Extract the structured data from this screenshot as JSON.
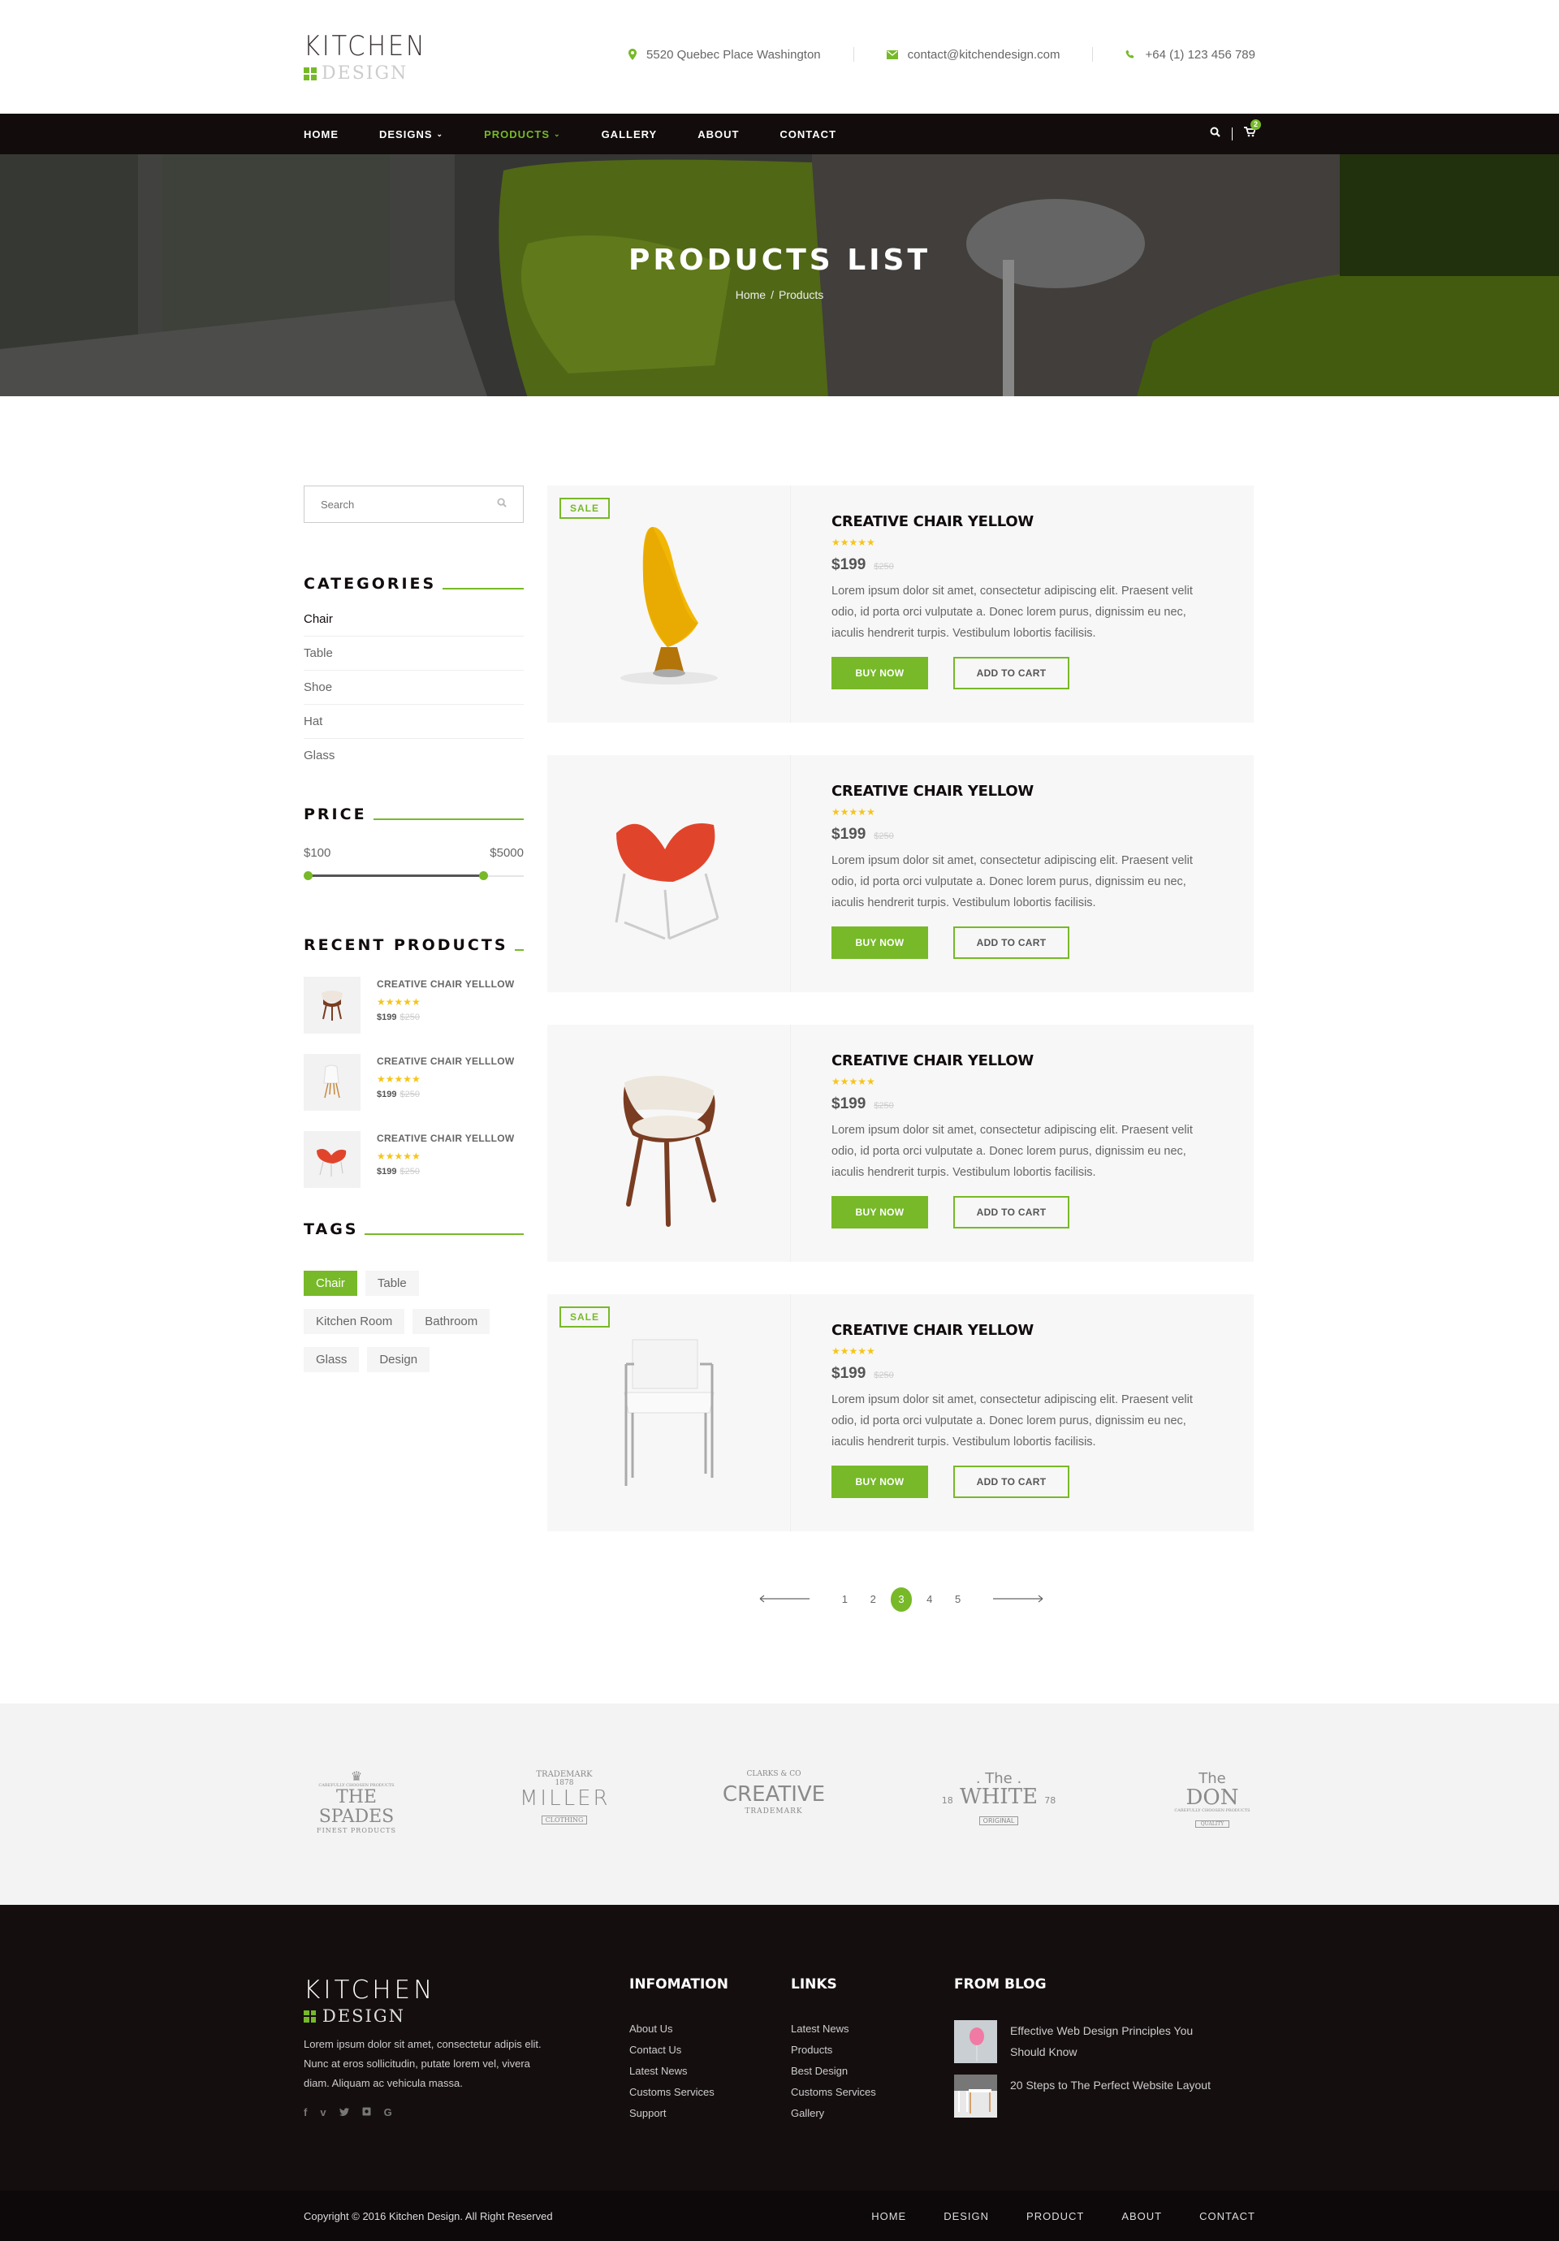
{
  "brand": {
    "line1": "KITCHEN",
    "line2": "DESIGN",
    "accent": "#77b928"
  },
  "contacts": {
    "address": "5520 Quebec Place Washington",
    "email": "contact@kitchendesign.com",
    "phone": "+64 (1) 123 456 789"
  },
  "nav": {
    "items": [
      "HOME",
      "DESIGNS",
      "PRODUCTS",
      "GALLERY",
      "ABOUT",
      "CONTACT"
    ],
    "active": "PRODUCTS",
    "cart_count": "2"
  },
  "hero": {
    "title": "PRODUCTS LIST",
    "crumb_home": "Home",
    "crumb_sep": "/",
    "crumb_current": "Products"
  },
  "sidebar": {
    "search_placeholder": "Search",
    "categories_title": "CATEGORIES",
    "categories": [
      "Chair",
      "Table",
      "Shoe",
      "Hat",
      "Glass"
    ],
    "price_title": "PRICE",
    "price_min": "$100",
    "price_max": "$5000",
    "price_range_fraction": [
      0,
      0.83
    ],
    "recent_title": "RECENT PRODUCTS",
    "recent": [
      {
        "name": "CREATIVE CHAIR YELLLOW",
        "stars": "★★★★★",
        "price": "$199",
        "old_price": "$250"
      },
      {
        "name": "CREATIVE CHAIR YELLLOW",
        "stars": "★★★★★",
        "price": "$199",
        "old_price": "$250"
      },
      {
        "name": "CREATIVE CHAIR YELLLOW",
        "stars": "★★★★★",
        "price": "$199",
        "old_price": "$250"
      }
    ],
    "tags_title": "TAGS",
    "tags": [
      "Chair",
      "Table",
      "Kitchen Room",
      "Bathroom",
      "Glass",
      "Design"
    ]
  },
  "products": [
    {
      "badge": "SALE",
      "title": "CREATIVE CHAIR YELLOW",
      "stars": "★★★★★",
      "price": "$199",
      "old_price": "$250",
      "desc": "Lorem ipsum dolor sit amet, consectetur adipiscing elit. Praesent velit odio, id porta orci vulputate a. Donec lorem purus, dignissim eu nec, iaculis hendrerit turpis. Vestibulum lobortis facilisis.",
      "buy": "BUY NOW",
      "cart": "ADD TO CART"
    },
    {
      "badge": "",
      "title": "CREATIVE CHAIR YELLOW",
      "stars": "★★★★★",
      "price": "$199",
      "old_price": "$250",
      "desc": "Lorem ipsum dolor sit amet, consectetur adipiscing elit. Praesent velit odio, id porta orci vulputate a. Donec lorem purus, dignissim eu nec, iaculis hendrerit turpis. Vestibulum lobortis facilisis.",
      "buy": "BUY NOW",
      "cart": "ADD TO CART"
    },
    {
      "badge": "",
      "title": "CREATIVE CHAIR YELLOW",
      "stars": "★★★★★",
      "price": "$199",
      "old_price": "$250",
      "desc": "Lorem ipsum dolor sit amet, consectetur adipiscing elit. Praesent velit odio, id porta orci vulputate a. Donec lorem purus, dignissim eu nec, iaculis hendrerit turpis. Vestibulum lobortis facilisis.",
      "buy": "BUY NOW",
      "cart": "ADD TO CART"
    },
    {
      "badge": "SALE",
      "title": "CREATIVE CHAIR YELLOW",
      "stars": "★★★★★",
      "price": "$199",
      "old_price": "$250",
      "desc": "Lorem ipsum dolor sit amet, consectetur adipiscing elit. Praesent velit odio, id porta orci vulputate a. Donec lorem purus, dignissim eu nec, iaculis hendrerit turpis. Vestibulum lobortis facilisis.",
      "buy": "BUY NOW",
      "cart": "ADD TO CART"
    }
  ],
  "pagination": {
    "pages": [
      "1",
      "2",
      "3",
      "4",
      "5"
    ],
    "current": "3"
  },
  "brands": [
    {
      "top": "CAREFULLY CHOOSEN PRODUCTS",
      "main": "THE SPADES",
      "bottom": "FINEST PRODUCTS"
    },
    {
      "top": "TRADEMARK",
      "year": "1878",
      "main": "MILLER",
      "bottom": "CLOTHING"
    },
    {
      "top": "CLARKS & CO",
      "main": "CREATIVE",
      "bottom": "TRADEMARK"
    },
    {
      "top": ". The .",
      "main": "WHITE",
      "left": "18",
      "right": "78",
      "bottom": "ORIGINAL"
    },
    {
      "top": "The",
      "main": "DON",
      "sub": "CAREFULLY CHOOSEN PRODUCTS",
      "bottom": "QUALITY"
    }
  ],
  "footer": {
    "about": "Lorem ipsum dolor sit amet, consectetur adipis elit. Nunc at eros sollicitudin, putate lorem vel, vivera diam. Aliquam ac vehicula massa.",
    "social": [
      "facebook",
      "vimeo",
      "twitter",
      "instagram",
      "google"
    ],
    "info_title": "INFOMATION",
    "info": [
      "About Us",
      "Contact Us",
      "Latest News",
      "Customs Services",
      "Support"
    ],
    "links_title": "LINKS",
    "links": [
      "Latest News",
      "Products",
      "Best Design",
      "Customs Services",
      "Gallery"
    ],
    "blog_title": "FROM BLOG",
    "blog": [
      "Effective Web Design Principles You Should Know",
      "20 Steps to The Perfect Website Layout"
    ],
    "copyright": "Copyright © 2016 Kitchen Design. All Right Reserved",
    "nav": [
      "HOME",
      "DESIGN",
      "PRODUCT",
      "ABOUT",
      "CONTACT"
    ]
  }
}
